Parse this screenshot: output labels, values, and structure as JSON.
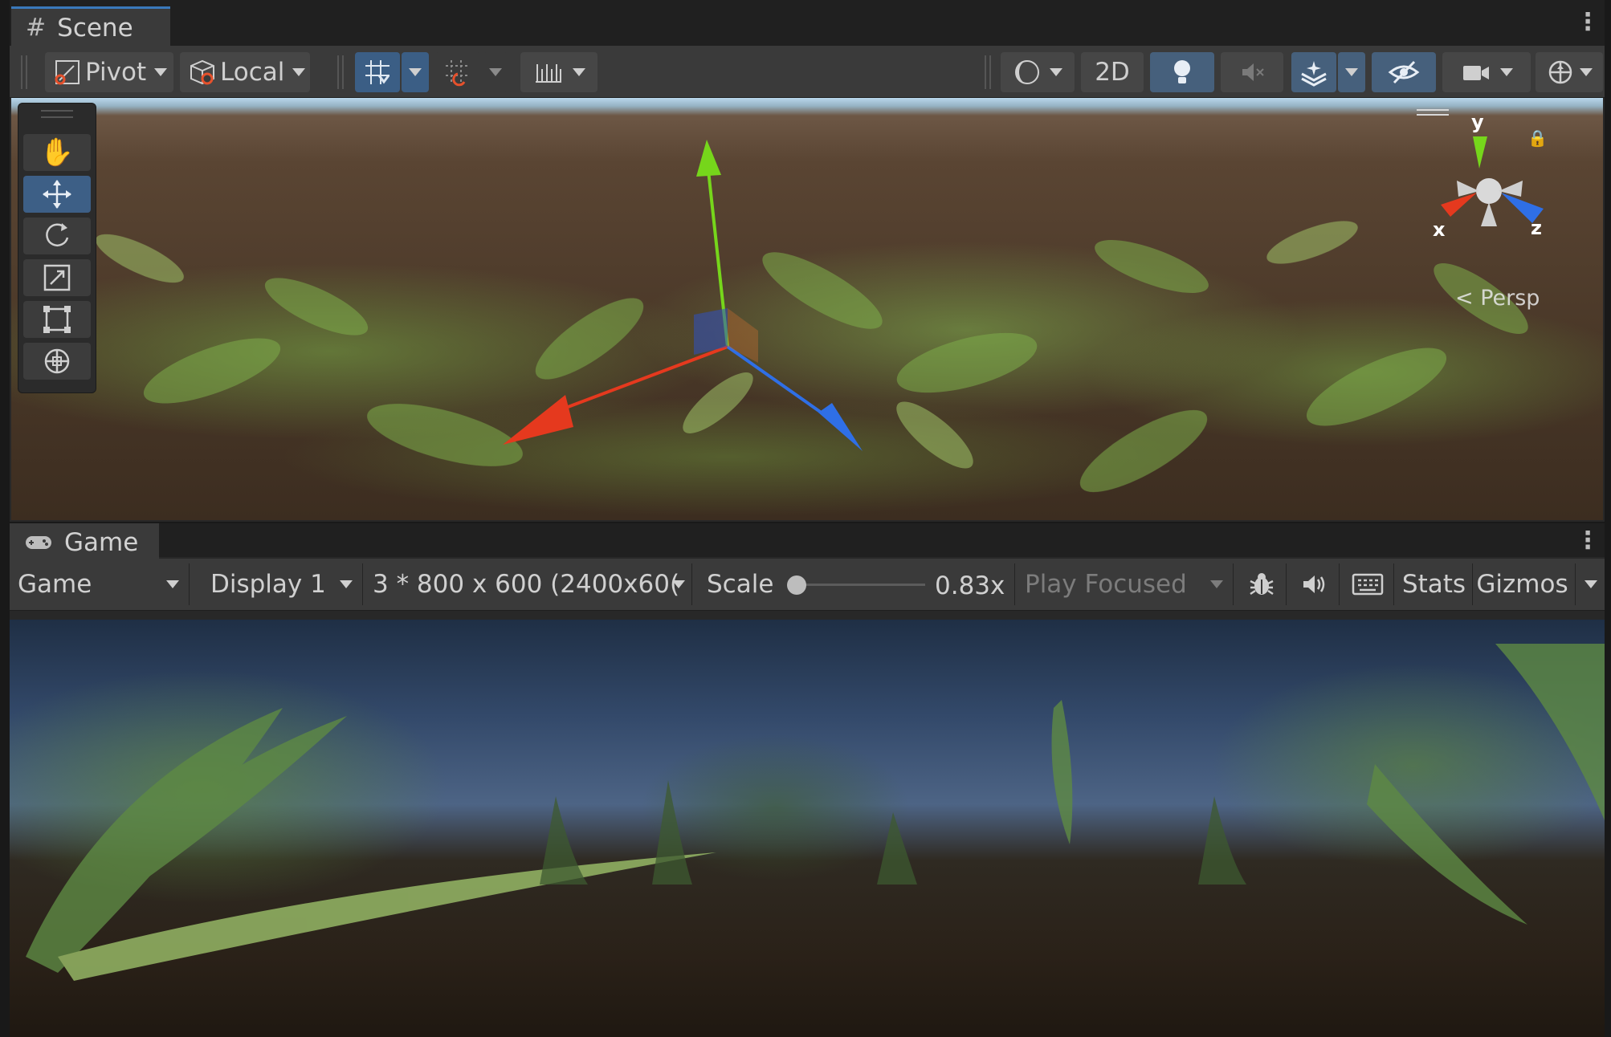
{
  "scene": {
    "tab_label": "Scene",
    "toolbar": {
      "pivot_label": "Pivot",
      "local_label": "Local",
      "twod_label": "2D"
    },
    "overlay": {
      "persp_label": "< Persp",
      "axis_y": "y",
      "axis_x": "x",
      "axis_z": "z"
    }
  },
  "game": {
    "tab_label": "Game",
    "toolbar": {
      "view_mode": "Game",
      "display": "Display 1",
      "resolution": "3 * 800 x 600 (2400x60(",
      "scale_label": "Scale",
      "scale_value": "0.83x",
      "play_mode": "Play Focused",
      "stats_label": "Stats",
      "gizmos_label": "Gizmos"
    }
  },
  "colors": {
    "accent": "#3a79bb",
    "selected_tool": "#3d5f86",
    "gizmo_x": "#e5391e",
    "gizmo_y": "#76d61b",
    "gizmo_z": "#2f6fe6"
  },
  "icons": [
    "hash-icon",
    "gamepad-icon",
    "hand-icon",
    "move-icon",
    "rotate-icon",
    "scale-icon",
    "rect-icon",
    "transform-icon",
    "bug-icon",
    "speaker-icon",
    "keyboard-icon"
  ]
}
